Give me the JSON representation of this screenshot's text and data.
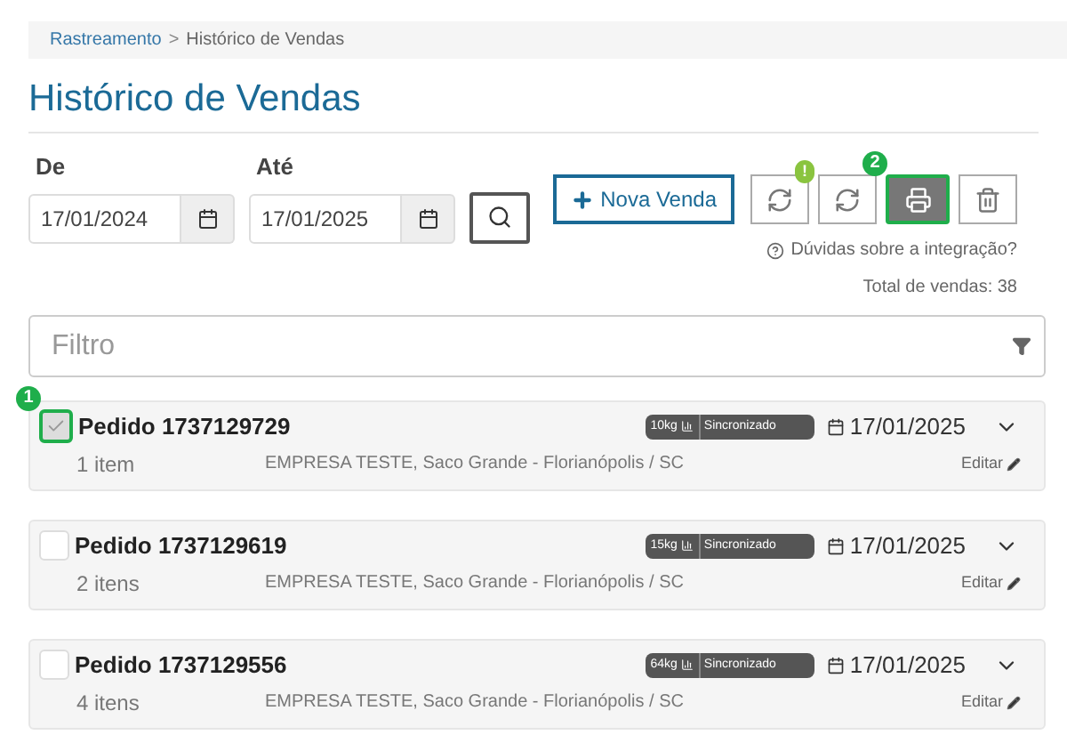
{
  "breadcrumb": {
    "link": "Rastreamento",
    "separator": ">",
    "current": "Histórico de Vendas"
  },
  "title": "Histórico de Vendas",
  "filters": [
    {
      "label": "De",
      "value": "17/01/2024"
    },
    {
      "label": "Até",
      "value": "17/01/2025"
    }
  ],
  "new_sale_button": "Nova Venda",
  "toolbar": [
    {
      "kind": "sync-alert",
      "badge": "!",
      "highlighted": false
    },
    {
      "kind": "sync",
      "highlighted": false
    },
    {
      "kind": "print",
      "marker": "2",
      "highlighted": true
    },
    {
      "kind": "delete",
      "highlighted": false
    }
  ],
  "help_link": "Dúvidas sobre a integração?",
  "total": "Total de vendas: 38",
  "filter_field": {
    "placeholder": "Filtro"
  },
  "orders": [
    {
      "title": "Pedido 1737129729",
      "checked": true,
      "marker": "1",
      "items": "1 item",
      "address": "EMPRESA TESTE, Saco Grande - Florianópolis / SC",
      "weight": "10kg",
      "status": "Sincronizado",
      "date": "17/01/2025",
      "action": "Editar"
    },
    {
      "title": "Pedido 1737129619",
      "checked": false,
      "items": "2 itens",
      "address": "EMPRESA TESTE, Saco Grande - Florianópolis / SC",
      "weight": "15kg",
      "status": "Sincronizado",
      "date": "17/01/2025",
      "action": "Editar"
    },
    {
      "title": "Pedido 1737129556",
      "checked": false,
      "items": "4 itens",
      "address": "EMPRESA TESTE, Saco Grande - Florianópolis / SC",
      "weight": "64kg",
      "status": "Sincronizado",
      "date": "17/01/2025",
      "action": "Editar"
    }
  ]
}
